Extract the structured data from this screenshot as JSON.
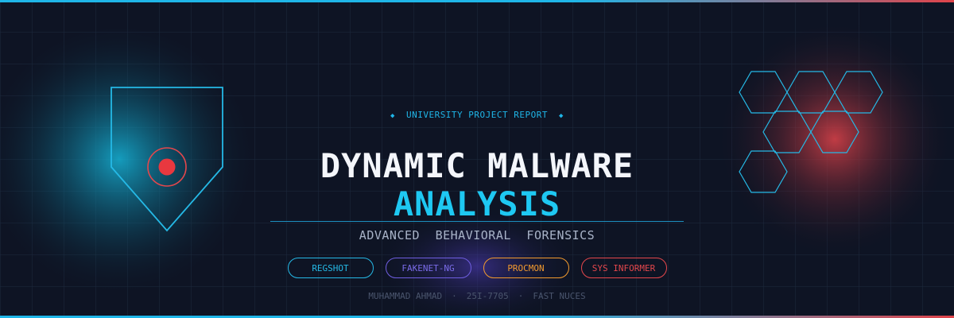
{
  "eyebrow": {
    "left_mark": "◆",
    "text": "UNIVERSITY PROJECT REPORT",
    "right_mark": "◆"
  },
  "title": {
    "line1": "DYNAMIC MALWARE",
    "line2": "ANALYSIS"
  },
  "subtitle": "ADVANCED BEHAVIORAL FORENSICS",
  "tags": [
    "REGSHOT",
    "FAKENET-NG",
    "PROCMON",
    "SYS INFORMER"
  ],
  "footer": {
    "name": "MUHAMMAD AHMAD",
    "separator": "·",
    "id": "25I-7705",
    "school": "FAST NUCES"
  },
  "colors": {
    "background": "#0e1424",
    "cyan": "#1fb6e8",
    "red": "#e0434a",
    "purple": "#6f5ee0",
    "orange": "#f29a2e"
  },
  "icons": [
    "shield-pin-icon",
    "hexagon-cluster-icon"
  ]
}
